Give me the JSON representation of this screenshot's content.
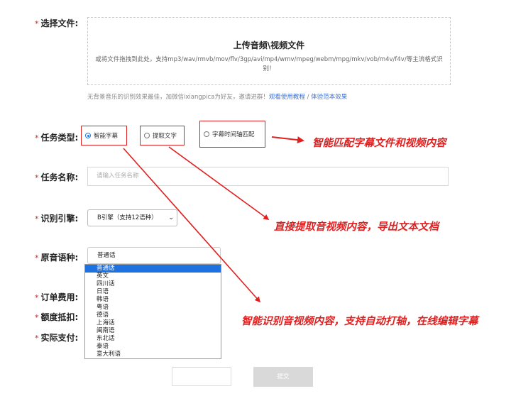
{
  "form": {
    "file_label": "选择文件:",
    "task_type_label": "任务类型:",
    "task_name_label": "任务名称:",
    "engine_label": "识别引擎:",
    "language_label": "原音语种:",
    "order_fee_label": "订单费用:",
    "quota_label": "额度抵扣:",
    "actual_pay_label": "实际支付:"
  },
  "upload": {
    "title": "上传音频\\视频文件",
    "description": "或将文件拖拽到此处，支持mp3/wav/rmvb/mov/flv/3gp/avi/mp4/wmv/mpeg/webm/mpg/mkv/vob/m4v/f4v/等主流格式识别！"
  },
  "hint": {
    "text": "无背景音乐的识别效果最佳，加微信ixiangpica为好友，邀请进群！",
    "tutorial_link": "观看使用教程",
    "separator": " / ",
    "sample_link": "体验范本效果"
  },
  "task_types": {
    "option1": "智能字幕",
    "option2": "提取文字",
    "option3": "字幕时间轴匹配"
  },
  "task_name": {
    "placeholder": "请输入任务名称"
  },
  "engine": {
    "selected": "B引擎（支持12语种）",
    "chevron": "⌄"
  },
  "language": {
    "selected": "普通话",
    "options": [
      "普通话",
      "英文",
      "四川话",
      "日语",
      "韩语",
      "粤语",
      "德语",
      "上海话",
      "闽南语",
      "东北话",
      "泰语",
      "意大利语"
    ]
  },
  "buttons": {
    "submit": "提交"
  },
  "annotations": {
    "text1": "智能匹配字幕文件和视频内容",
    "text2": "直接提取音视频内容，导出文本文档",
    "text3": "智能识别音视频内容，支持自动打轴，在线编辑字幕"
  },
  "required_mark": "*",
  "colors": {
    "accent": "#1e72e0",
    "annotation": "#e02020"
  }
}
